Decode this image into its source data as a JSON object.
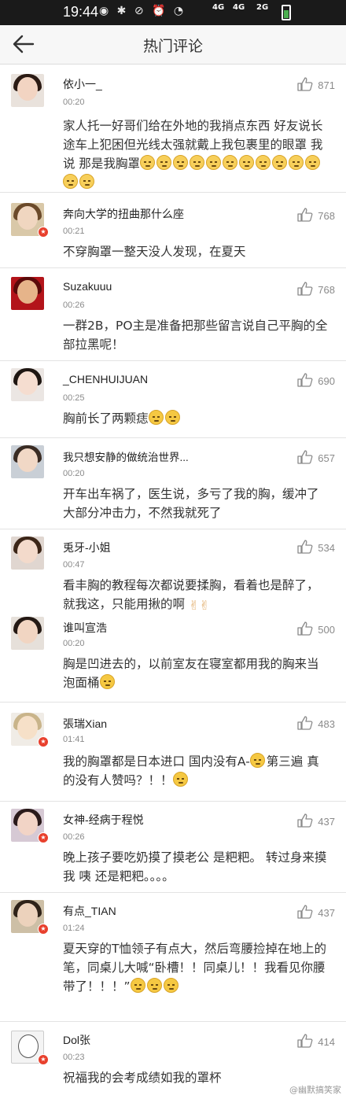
{
  "status_bar": {
    "time": "19:44",
    "net1": "4G",
    "net2": "4G",
    "net3": "2G",
    "battery_level": 0.6
  },
  "header": {
    "title": "热门评论",
    "back_icon": "arrow-left-icon"
  },
  "comments": [
    {
      "name": "依小一_",
      "time": "00:20",
      "likes": "871",
      "text": "家人托一好哥们给在外地的我捎点东西 好友说长途车上犯困但光线太强就戴上我包裹里的眼罩 我说 那是我胸罩",
      "emoji_count": 13
    },
    {
      "name": "奔向大学的扭曲那什么座",
      "time": "00:21",
      "likes": "768",
      "text": "不穿胸罩一整天没人发现，在夏天",
      "emoji_count": 0
    },
    {
      "name": "Suzakuuu",
      "time": "00:26",
      "likes": "768",
      "text": "一群2B，PO主是准备把那些留言说自己平胸的全部拉黑呢！",
      "emoji_count": 0
    },
    {
      "name": "_CHENHUIJUAN",
      "time": "00:25",
      "likes": "690",
      "text": "胸前长了两颗痣",
      "emoji_count": 2
    },
    {
      "name": "我只想安静的做统治世界...",
      "time": "00:20",
      "likes": "657",
      "text": "开车出车祸了，医生说，多亏了我的胸，缓冲了大部分冲击力，不然我就死了",
      "emoji_count": 0
    },
    {
      "name": "兎牙-小姐",
      "time": "00:47",
      "likes": "534",
      "text": "看丰胸的教程每次都说要揉胸，看着也是醉了，就我这，只能用揪的啊",
      "emoji_count": 0
    },
    {
      "name": "谁叫宣浩",
      "time": "00:20",
      "likes": "500",
      "text": "胸是凹进去的，以前室友在寝室都用我的胸来当泡面桶",
      "emoji_count": 1
    },
    {
      "name": "張瑞Xian",
      "time": "01:41",
      "likes": "483",
      "text_a": "我的胸罩都是日本进口  国内没有A-",
      "text_b": "第三遍 真的没有人赞吗？！！",
      "emoji_count": 2
    },
    {
      "name": "女神-经病于程悦",
      "time": "00:26",
      "likes": "437",
      "text": "晚上孩子要吃奶摸了摸老公 是粑粑。 转过身来摸我 咦 还是粑粑。。。。",
      "emoji_count": 0
    },
    {
      "name": "有点_TIAN",
      "time": "01:24",
      "likes": "437",
      "text": "夏天穿的T恤领子有点大，然后弯腰捡掉在地上的笔，同桌儿大喊“卧槽！！同桌儿！！我看见你腰带了！！！”",
      "emoji_count": 3
    },
    {
      "name": "Dol张",
      "time": "00:23",
      "likes": "414",
      "text": "祝福我的会考成绩如我的罩杯",
      "emoji_count": 0
    }
  ],
  "watermark": "@幽默搞笑家"
}
